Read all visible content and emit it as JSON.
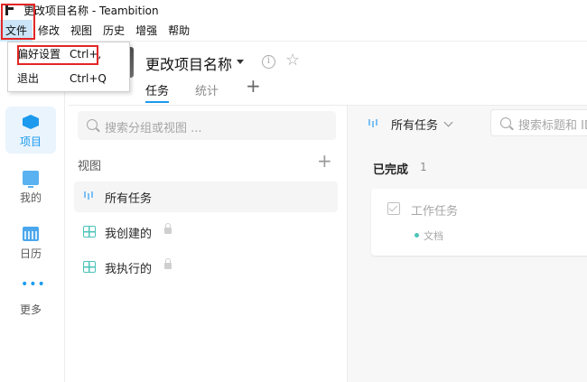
{
  "window": {
    "title": "更改项目名称 - Teambition"
  },
  "menubar": [
    {
      "label": "文件",
      "active": true
    },
    {
      "label": "修改"
    },
    {
      "label": "视图"
    },
    {
      "label": "历史"
    },
    {
      "label": "增强"
    },
    {
      "label": "帮助"
    }
  ],
  "dropdown": {
    "items": [
      {
        "label": "偏好设置",
        "shortcut": "Ctrl+,"
      },
      {
        "label": "退出",
        "shortcut": "Ctrl+Q"
      }
    ]
  },
  "project": {
    "title": "更改项目名称",
    "tabs": [
      {
        "label": "任务",
        "active": true
      },
      {
        "label": "统计"
      }
    ]
  },
  "leftnav": [
    {
      "label": "项目",
      "icon": "project-icon",
      "active": true
    },
    {
      "label": "我的",
      "icon": "monitor-icon"
    },
    {
      "label": "日历",
      "icon": "calendar-icon"
    },
    {
      "label": "更多",
      "icon": "more-dots-icon"
    }
  ],
  "views": {
    "search_placeholder": "搜索分组或视图 ...",
    "title": "视图",
    "items": [
      {
        "label": "所有任务",
        "icon": "all-tasks-icon",
        "active": true,
        "locked": false
      },
      {
        "label": "我创建的",
        "icon": "table-icon",
        "locked": true
      },
      {
        "label": "我执行的",
        "icon": "table-icon",
        "locked": true
      }
    ]
  },
  "tasks": {
    "filter_label": "所有任务",
    "search_placeholder": "搜索标题和 ID",
    "group": {
      "title": "已完成",
      "count": "1"
    },
    "card": {
      "title": "工作任务",
      "tag": "文档"
    }
  },
  "colors": {
    "accent": "#1b9aee",
    "highlight": "#e32626",
    "teal": "#4cc3b8"
  }
}
